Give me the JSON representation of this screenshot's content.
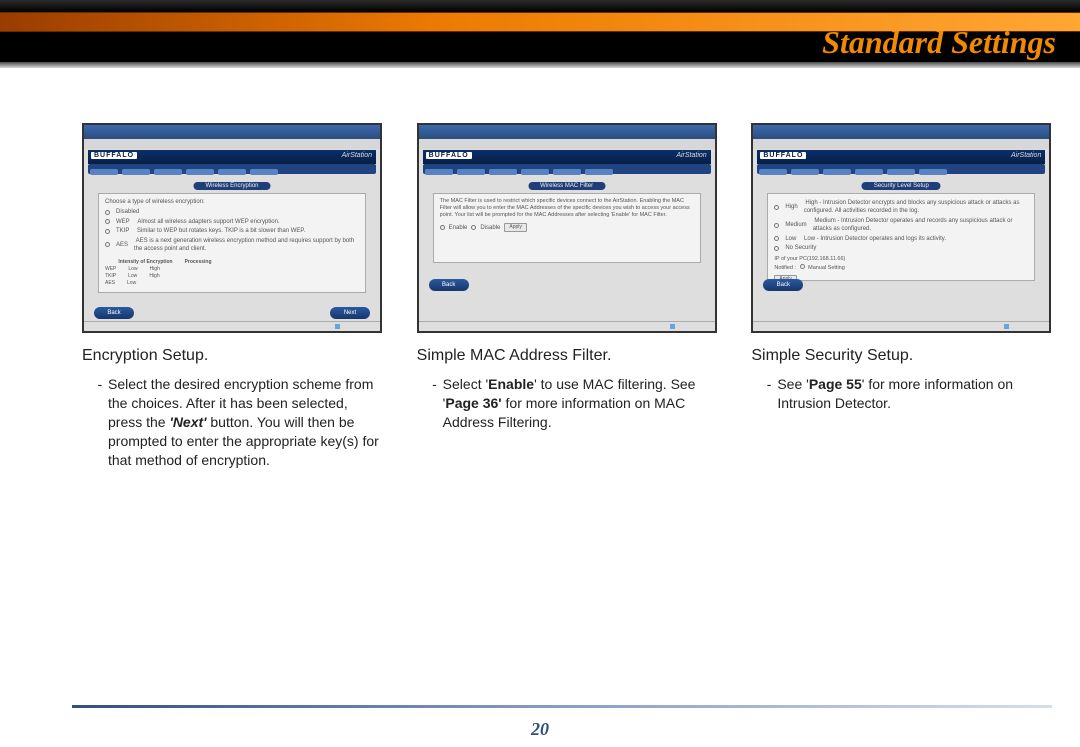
{
  "header": {
    "title": "Standard Settings"
  },
  "columns": [
    {
      "screenshot": {
        "brand": "BUFFALO",
        "product": "AirStation",
        "caption_bar": "Wireless Encryption",
        "panel_rows": [
          "Disabled",
          "WEP",
          "TKIP",
          "AES"
        ],
        "mini_table": [
          [
            "WEP",
            "Low",
            "High"
          ],
          [
            "TKIP",
            "Low",
            "High"
          ],
          [
            "AES",
            "Low"
          ]
        ],
        "back": "Back",
        "next": "Next"
      },
      "caption": "Encryption Setup.",
      "body_segments": [
        {
          "t": "text",
          "v": "Select the desired encryption scheme from the choices.  After it has been selected, press the "
        },
        {
          "t": "bolditalic",
          "v": "'Next'"
        },
        {
          "t": "text",
          "v": " button.  You will then be prompted to enter the appropriate key(s) for that method of encryption."
        }
      ]
    },
    {
      "screenshot": {
        "brand": "BUFFALO",
        "product": "AirStation",
        "caption_bar": "Wireless MAC Filter",
        "panel_text": "The MAC Filter is used to restrict which specific devices connect to the AirStation. Enabling the MAC Filter will allow you to enter the MAC Addresses of the specific devices you wish to access your access point. Your list will be prompted for the MAC Addresses after selecting 'Enable' for MAC Filter.",
        "enable_label": "Enable",
        "disable_label": "Disable",
        "apply": "Apply",
        "back": "Back"
      },
      "caption": "Simple MAC Address Filter.",
      "body_segments": [
        {
          "t": "text",
          "v": "Select '"
        },
        {
          "t": "bold",
          "v": "Enable"
        },
        {
          "t": "text",
          "v": "' to use MAC filtering.  See '"
        },
        {
          "t": "bold",
          "v": "Page 36'"
        },
        {
          "t": "text",
          "v": " for more information on MAC Address Filtering."
        }
      ]
    },
    {
      "screenshot": {
        "brand": "BUFFALO",
        "product": "AirStation",
        "caption_bar": "Security Level Setup",
        "panel_rows": [
          "High",
          "Medium",
          "Low",
          "No Security"
        ],
        "apply": "Apply",
        "back": "Back"
      },
      "caption": "Simple Security Setup.",
      "body_segments": [
        {
          "t": "text",
          "v": "See '"
        },
        {
          "t": "bold",
          "v": "Page 55"
        },
        {
          "t": "text",
          "v": "' for more information on Intrusion Detector."
        }
      ]
    }
  ],
  "page_number": "20"
}
